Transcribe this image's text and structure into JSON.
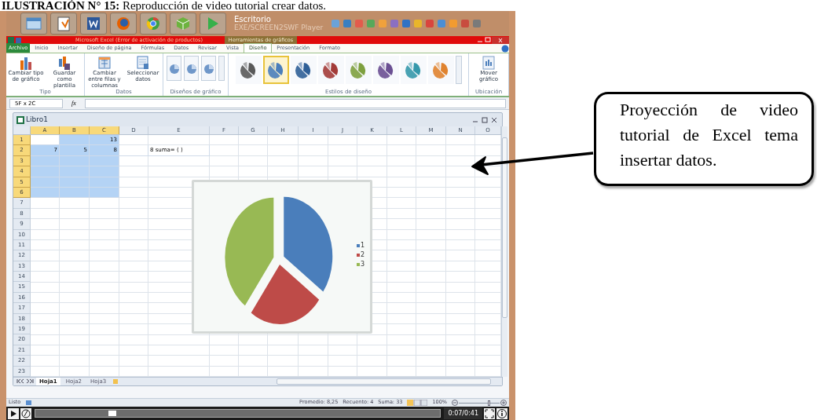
{
  "caption": "**ILUSTRACIÓN N° 15:** Reproducción de video tutorial crear datos.",
  "taskbar": {
    "label": "Escritorio",
    "player_title": "EXE/SCREEN2SWF Player"
  },
  "excel": {
    "title": "Microsoft Excel (Error de activación de productos)",
    "context_tab": "Herramientas de gráficos",
    "tabs": [
      {
        "label": "Archivo",
        "selected": false,
        "kind": "file"
      },
      {
        "label": "Inicio",
        "selected": false,
        "kind": "tab"
      },
      {
        "label": "Insertar",
        "selected": false,
        "kind": "tab"
      },
      {
        "label": "Diseño de página",
        "selected": false,
        "kind": "tab"
      },
      {
        "label": "Fórmulas",
        "selected": false,
        "kind": "tab"
      },
      {
        "label": "Datos",
        "selected": false,
        "kind": "tab"
      },
      {
        "label": "Revisar",
        "selected": false,
        "kind": "tab"
      },
      {
        "label": "Vista",
        "selected": false,
        "kind": "tab"
      },
      {
        "label": "Diseño",
        "selected": true,
        "kind": "tab"
      },
      {
        "label": "Presentación",
        "selected": false,
        "kind": "tab"
      },
      {
        "label": "Formato",
        "selected": false,
        "kind": "tab"
      }
    ],
    "ribbon": [
      {
        "label": "Tipo",
        "kind": "buttons",
        "buttons": [
          "Cambiar tipo de gráfico",
          "Guardar como plantilla"
        ]
      },
      {
        "label": "Datos",
        "kind": "buttons",
        "buttons": [
          "Cambiar entre filas y columnas",
          "Seleccionar datos"
        ]
      },
      {
        "label": "Diseños de gráfico",
        "kind": "layouts"
      },
      {
        "label": "Estilos de diseño",
        "kind": "styles",
        "styles": [
          {
            "color": "#595959",
            "selected": false
          },
          {
            "color": "#4a7ebb",
            "selected": true
          },
          {
            "color": "#2f5f97",
            "selected": false
          },
          {
            "color": "#a33b38",
            "selected": false
          },
          {
            "color": "#7ea03f",
            "selected": false
          },
          {
            "color": "#6a4f92",
            "selected": false
          },
          {
            "color": "#3598ab",
            "selected": false
          },
          {
            "color": "#e0832f",
            "selected": false
          }
        ]
      },
      {
        "label": "Ubicación",
        "kind": "buttons",
        "buttons": [
          "Mover gráfico"
        ]
      }
    ],
    "name_box": "5F x 2C",
    "fx": "fx"
  },
  "workbook": {
    "title": "Libro1",
    "columns": [
      {
        "label": "A",
        "selected": true
      },
      {
        "label": "B",
        "selected": true
      },
      {
        "label": "C",
        "selected": true
      },
      {
        "label": "D",
        "selected": false
      },
      {
        "label": "E",
        "selected": false
      },
      {
        "label": "F",
        "selected": false
      },
      {
        "label": "G",
        "selected": false
      },
      {
        "label": "H",
        "selected": false
      },
      {
        "label": "I",
        "selected": false
      },
      {
        "label": "J",
        "selected": false
      },
      {
        "label": "K",
        "selected": false
      },
      {
        "label": "L",
        "selected": false
      },
      {
        "label": "M",
        "selected": false
      },
      {
        "label": "N",
        "selected": false
      },
      {
        "label": "O",
        "selected": false
      }
    ],
    "rows": [
      {
        "header": "1",
        "selected": true,
        "cells": [
          {
            "selected": true,
            "active": true
          },
          {
            "selected": true,
            "active": false
          },
          {
            "selected": true,
            "active": false,
            "text": "13"
          }
        ]
      },
      {
        "header": "2",
        "selected": true,
        "cells": [
          {
            "selected": true,
            "active": false,
            "text": "7"
          },
          {
            "selected": true,
            "active": false,
            "text": "5"
          },
          {
            "selected": true,
            "active": false,
            "text": "8"
          },
          {
            "selected": false,
            "active": false
          },
          {
            "selected": false,
            "active": false,
            "text": "8 suma= ( )"
          }
        ]
      },
      {
        "header": "3",
        "selected": true,
        "cells": [
          {
            "selected": true,
            "active": false
          },
          {
            "selected": true,
            "active": false
          },
          {
            "selected": true,
            "active": false
          }
        ]
      },
      {
        "header": "4",
        "selected": true,
        "cells": [
          {
            "selected": true,
            "active": false
          },
          {
            "selected": true,
            "active": false
          },
          {
            "selected": true,
            "active": false
          }
        ]
      },
      {
        "header": "5",
        "selected": true,
        "cells": [
          {
            "selected": true,
            "active": false
          },
          {
            "selected": true,
            "active": false
          },
          {
            "selected": true,
            "active": false
          }
        ]
      },
      {
        "header": "6",
        "selected": true,
        "cells": [
          {
            "selected": true,
            "active": false
          },
          {
            "selected": true,
            "active": false
          },
          {
            "selected": true,
            "active": false
          }
        ]
      },
      {
        "header": "7",
        "selected": false
      },
      {
        "header": "8",
        "selected": false
      },
      {
        "header": "9",
        "selected": false
      },
      {
        "header": "10",
        "selected": false
      },
      {
        "header": "11",
        "selected": false
      },
      {
        "header": "12",
        "selected": false
      },
      {
        "header": "13",
        "selected": false
      },
      {
        "header": "14",
        "selected": false
      },
      {
        "header": "15",
        "selected": false
      },
      {
        "header": "16",
        "selected": false
      },
      {
        "header": "17",
        "selected": false
      },
      {
        "header": "18",
        "selected": false
      },
      {
        "header": "19",
        "selected": false
      },
      {
        "header": "20",
        "selected": false
      },
      {
        "header": "21",
        "selected": false
      },
      {
        "header": "22",
        "selected": false
      },
      {
        "header": "23",
        "selected": false
      }
    ],
    "chart": {
      "legend": [
        {
          "label": "1",
          "color": "#4a7ebb"
        },
        {
          "label": "2",
          "color": "#be4b48"
        },
        {
          "label": "3",
          "color": "#98b954"
        }
      ]
    },
    "sheets": [
      {
        "label": "Hoja1",
        "selected": true
      },
      {
        "label": "Hoja2",
        "selected": false
      },
      {
        "label": "Hoja3",
        "selected": false
      }
    ]
  },
  "status_bar": {
    "mode": "Listo",
    "average": "Promedio: 8,25",
    "count": "Recuento: 4",
    "sum": "Suma: 33",
    "zoom": "100%",
    "zoom_slider": {
      "level": 0.75
    }
  },
  "player": {
    "time": "0:07/0:41",
    "level": 0.18
  },
  "callout": "Proyección de video tutorial de Excel tema insertar datos."
}
